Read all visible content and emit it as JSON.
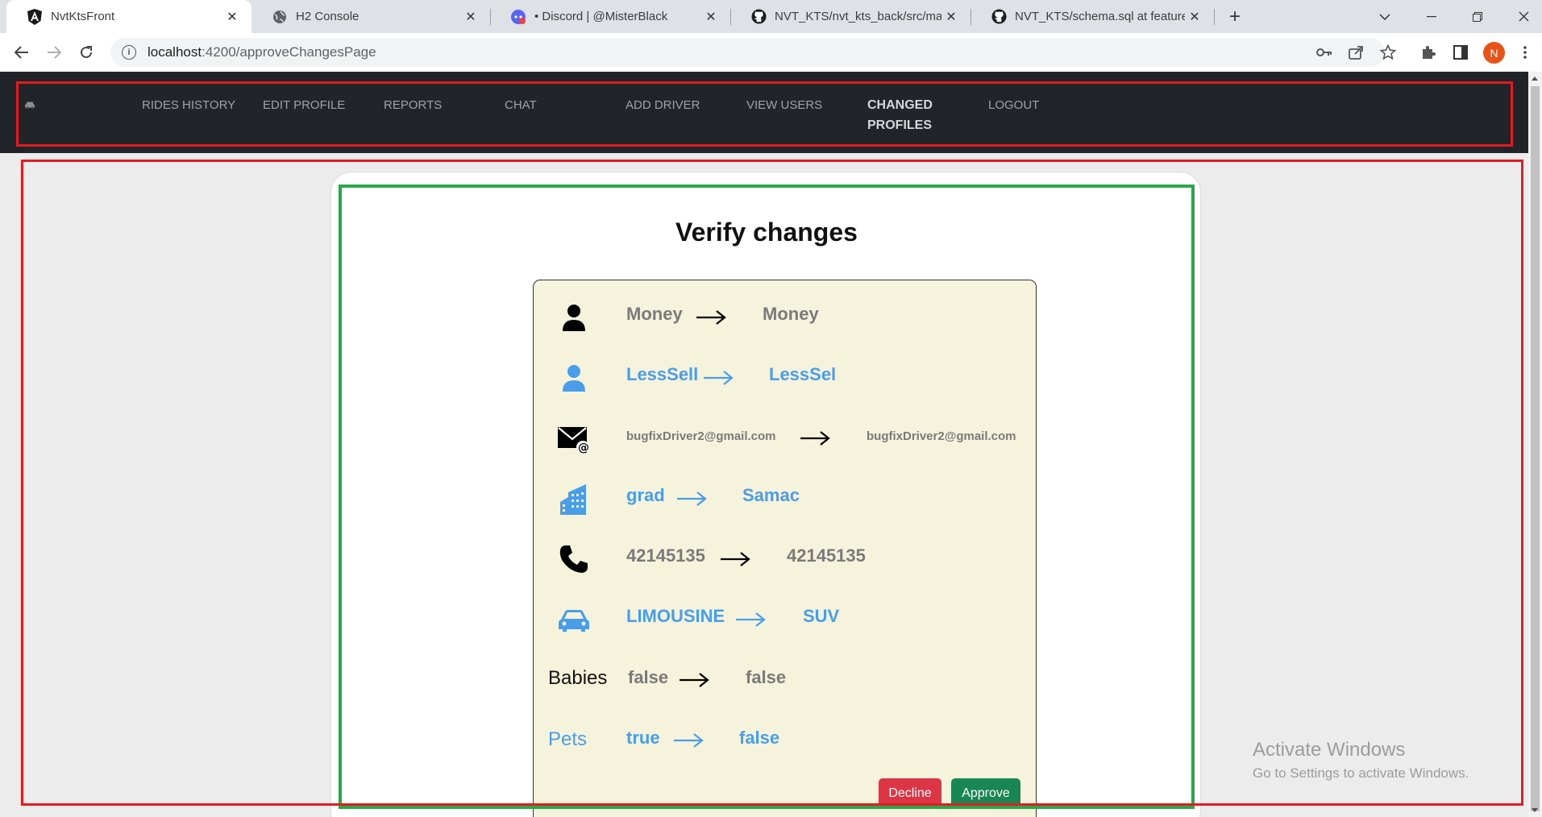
{
  "browser": {
    "tabs": [
      {
        "title": "NvtKtsFront",
        "icon": "angular-icon",
        "active": true
      },
      {
        "title": "H2 Console",
        "icon": "globe-icon",
        "active": false
      },
      {
        "title": "• Discord | @MisterBlack",
        "icon": "discord-icon",
        "active": false
      },
      {
        "title": "NVT_KTS/nvt_kts_back/src/main/",
        "icon": "github-icon",
        "active": false
      },
      {
        "title": "NVT_KTS/schema.sql at feature_b",
        "icon": "github-icon",
        "active": false
      }
    ],
    "new_tab": "+",
    "address": {
      "host": "localhost",
      "path": ":4200/approveChangesPage"
    },
    "profile_initial": "N"
  },
  "navbar": {
    "brand_icon": "car-icon",
    "links": [
      {
        "label": "RIDES HISTORY",
        "active": false
      },
      {
        "label": "EDIT PROFILE",
        "active": false
      },
      {
        "label": "REPORTS",
        "active": false
      },
      {
        "label": "CHAT",
        "active": false
      },
      {
        "label": "ADD DRIVER",
        "active": false
      },
      {
        "label": "VIEW USERS",
        "active": false
      },
      {
        "label": "CHANGED PROFILES",
        "active": true
      },
      {
        "label": "LOGOUT",
        "active": false
      }
    ]
  },
  "page": {
    "title": "Verify changes",
    "changes": [
      {
        "field_icon": "person-icon",
        "old": "Money",
        "new": "Money",
        "color": "#7a7a7a"
      },
      {
        "field_icon": "person-icon",
        "old": "LessSell",
        "new": "LessSel",
        "color": "#4a9de8"
      },
      {
        "field_icon": "email-icon",
        "old": "bugfixDriver2@gmail.com",
        "new": "bugfixDriver2@gmail.com",
        "color": "#7a7a7a"
      },
      {
        "field_icon": "building-icon",
        "old": "grad",
        "new": "Samac",
        "color": "#4a9de8"
      },
      {
        "field_icon": "phone-icon",
        "old": "42145135",
        "new": "42145135",
        "color": "#7a7a7a"
      },
      {
        "field_icon": "car-icon",
        "old": "LIMOUSINE",
        "new": "SUV",
        "color": "#4a9de8"
      },
      {
        "field_label": "Babies",
        "old": "false",
        "new": "false",
        "color": "#7a7a7a"
      },
      {
        "field_label": "Pets",
        "old": "true",
        "new": "false",
        "color": "#4a9de8"
      }
    ],
    "decline_label": "Decline",
    "approve_label": "Approve"
  },
  "os": {
    "watermark_title": "Activate Windows",
    "watermark_subtitle": "Go to Settings to activate Windows."
  }
}
